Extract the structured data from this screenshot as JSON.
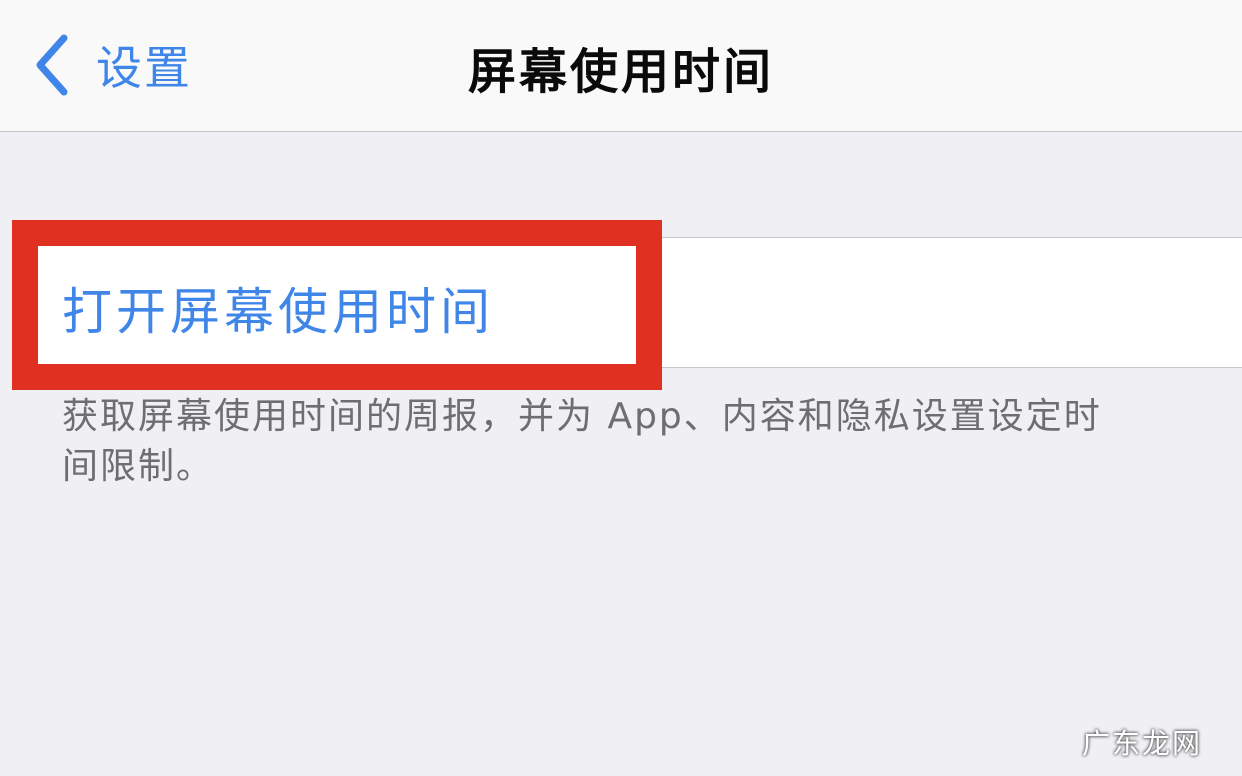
{
  "nav": {
    "back_label": "设置",
    "title": "屏幕使用时间"
  },
  "cell": {
    "label": "打开屏幕使用时间"
  },
  "footer": {
    "text": "获取屏幕使用时间的周报，并为 App、内容和隐私设置设定时间限制。"
  },
  "watermark": "广东龙网",
  "icons": {
    "back": "chevron-left-icon"
  },
  "colors": {
    "accent": "#3f86e8",
    "highlight": "#e03021",
    "background": "#efeff4"
  }
}
